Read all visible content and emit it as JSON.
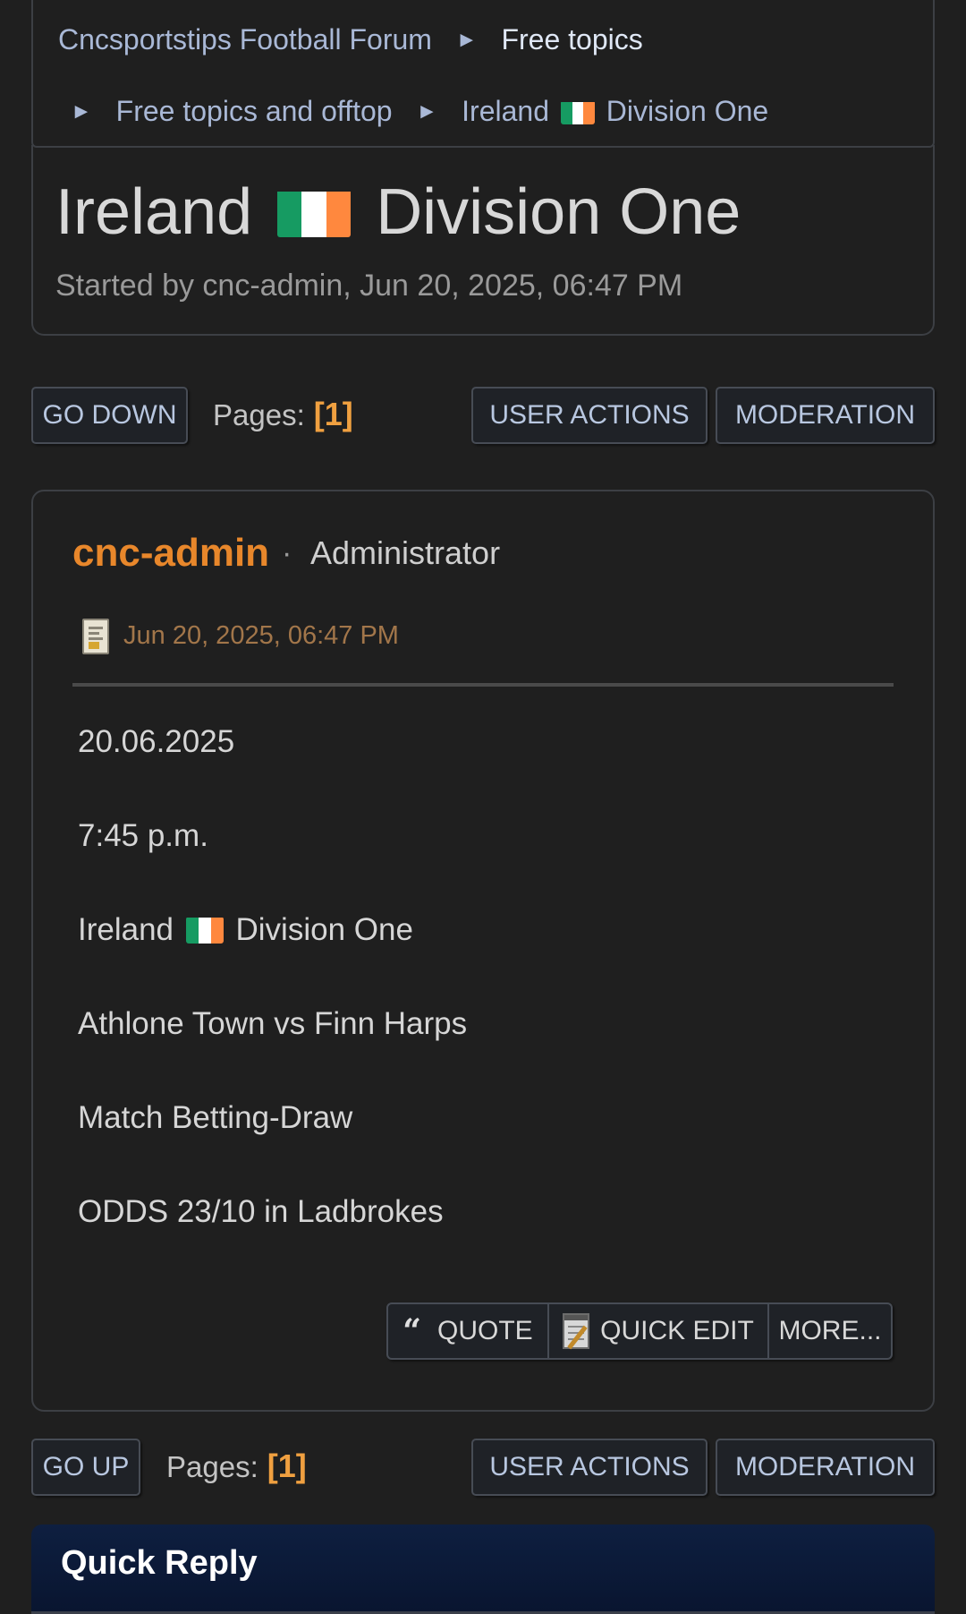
{
  "breadcrumb": {
    "items": [
      "Cncsportstips Football Forum",
      "Free topics",
      "Free topics and offtop",
      "Ireland",
      "Division One"
    ],
    "separator": "►"
  },
  "topic": {
    "title_prefix": "Ireland",
    "title_suffix": "Division One",
    "subtitle": "Started by cnc-admin, Jun 20, 2025, 06:47 PM"
  },
  "nav_top": {
    "go_label": "GO DOWN",
    "pages_label": "Pages:",
    "current_page": "[1]",
    "user_actions_label": "USER ACTIONS",
    "moderation_label": "MODERATION"
  },
  "nav_bottom": {
    "go_label": "GO UP",
    "pages_label": "Pages:",
    "current_page": "[1]",
    "user_actions_label": "USER ACTIONS",
    "moderation_label": "MODERATION"
  },
  "post": {
    "author": "cnc-admin",
    "separator": "·",
    "role": "Administrator",
    "date": "Jun 20, 2025, 06:47 PM",
    "lines": {
      "date": "20.06.2025",
      "time": "7:45 p.m.",
      "league_prefix": "Ireland",
      "league_suffix": "Division One",
      "match": "Athlone Town vs Finn Harps",
      "market": "Match Betting-Draw",
      "odds": "ODDS 23/10 in Ladbrokes"
    },
    "actions": {
      "quote": "QUOTE",
      "quick_edit": "QUICK EDIT",
      "more": "MORE..."
    }
  },
  "quick_reply": {
    "title": "Quick Reply"
  },
  "icons": {
    "flag": "ireland-flag-icon",
    "post_icon": "document-icon",
    "quote": "quote-icon",
    "edit": "notepad-icon"
  },
  "colors": {
    "background": "#1f1f1f",
    "author": "#e8872b",
    "current_page": "#f0a040",
    "link": "#a9b8d6",
    "quick_reply_bg": "#0e1f40"
  }
}
